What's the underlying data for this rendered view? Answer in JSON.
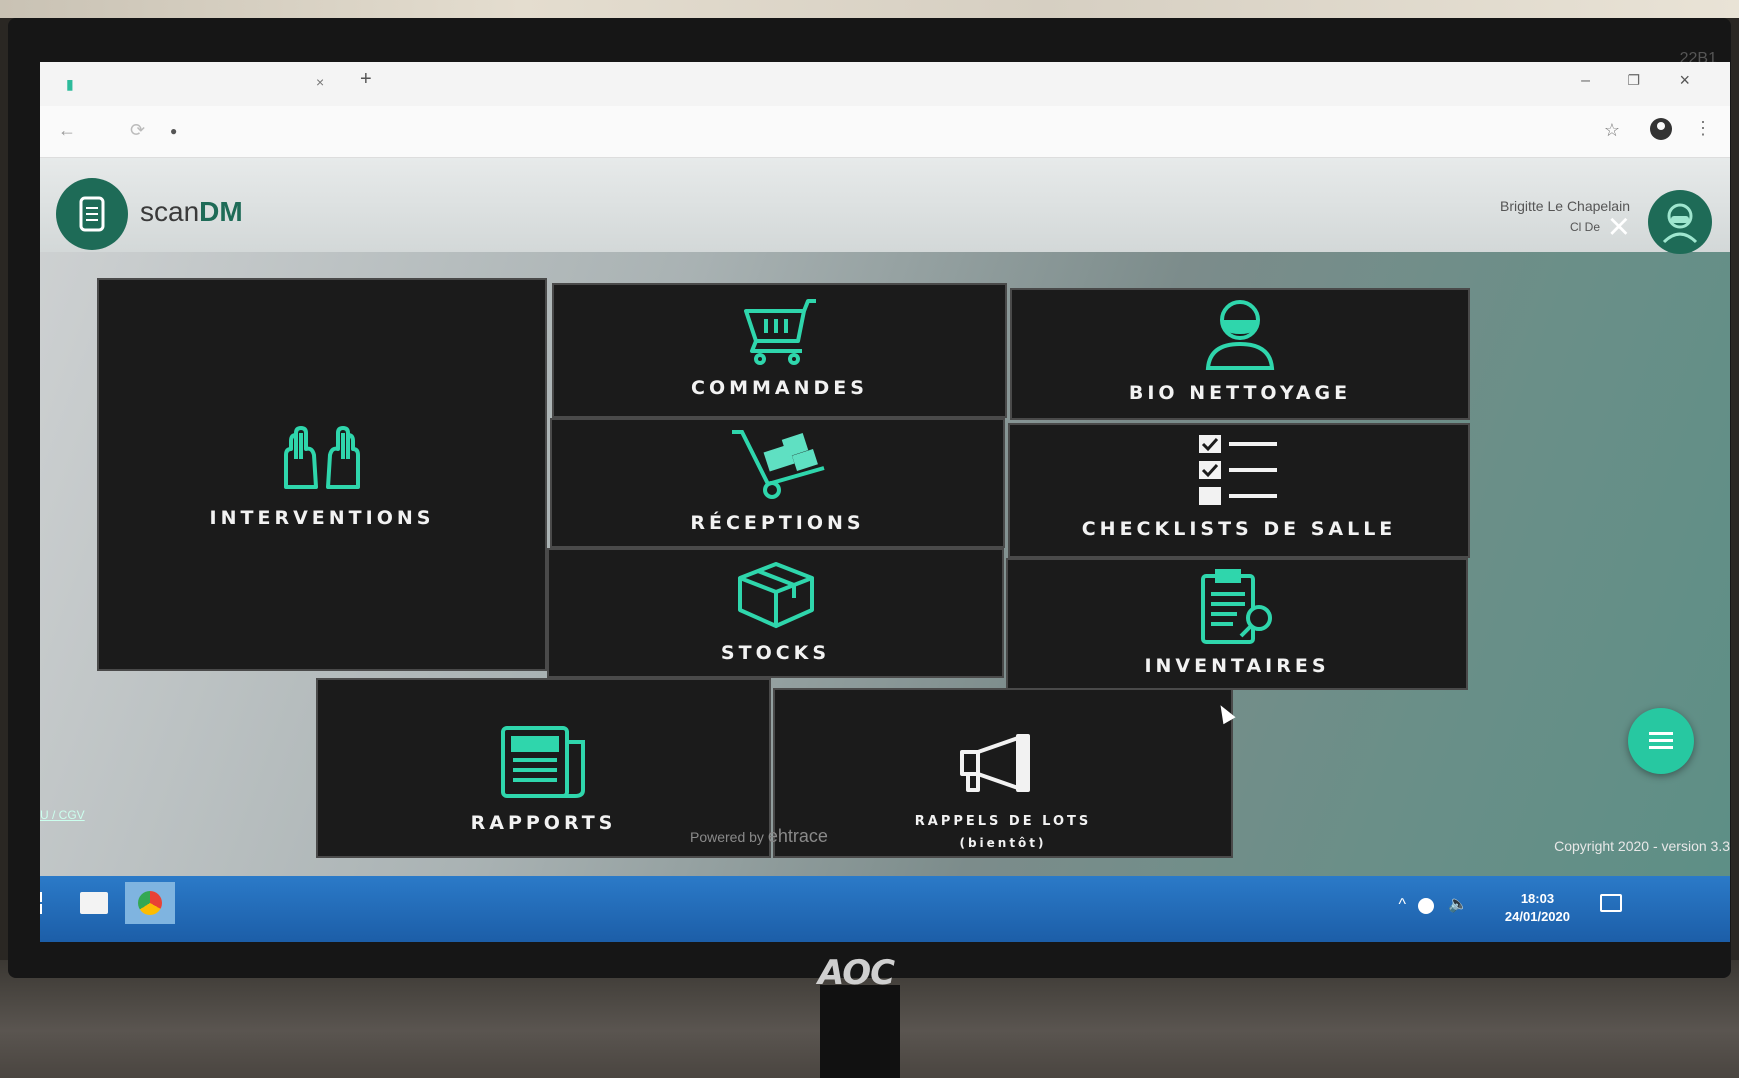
{
  "monitor": {
    "brand": "AOC",
    "corner_code": "22B1"
  },
  "browser": {
    "window_controls": {
      "minimize": "–",
      "maximize": "❐",
      "close": "×"
    }
  },
  "app": {
    "logo_prefix": "scan",
    "logo_suffix": "DM",
    "brand_color": "#1e6b57",
    "accent_color": "#27c8a1",
    "user": {
      "name": "Brigitte Le Chapelain",
      "subtitle": "Cl De"
    },
    "overlay_close": "×",
    "tiles": {
      "interventions": {
        "label": "INTERVENTIONS",
        "icon": "hands-icon"
      },
      "commandes": {
        "label": "COMMANDES",
        "icon": "cart-icon"
      },
      "bio_nettoyage": {
        "label": "BIO NETTOYAGE",
        "icon": "masked-person-icon"
      },
      "receptions": {
        "label": "RÉCEPTIONS",
        "icon": "hand-truck-icon"
      },
      "checklists": {
        "label": "CHECKLISTS DE SALLE",
        "icon": "checklist-icon"
      },
      "stocks": {
        "label": "STOCKS",
        "icon": "box-icon"
      },
      "inventaires": {
        "label": "INVENTAIRES",
        "icon": "clipboard-icon"
      },
      "rapports": {
        "label": "RAPPORTS",
        "icon": "report-icon"
      },
      "rappels": {
        "label": "RAPPELS DE LOTS",
        "sublabel": "(bientôt)",
        "icon": "megaphone-icon"
      }
    },
    "footer": {
      "cgu": "CGU / CGV",
      "powered_by": "Powered by",
      "powered_brand": "ehtrace",
      "copyright": "Copyright 2020 - version 3.3"
    }
  },
  "taskbar": {
    "time": "18:03",
    "date": "24/01/2020"
  }
}
